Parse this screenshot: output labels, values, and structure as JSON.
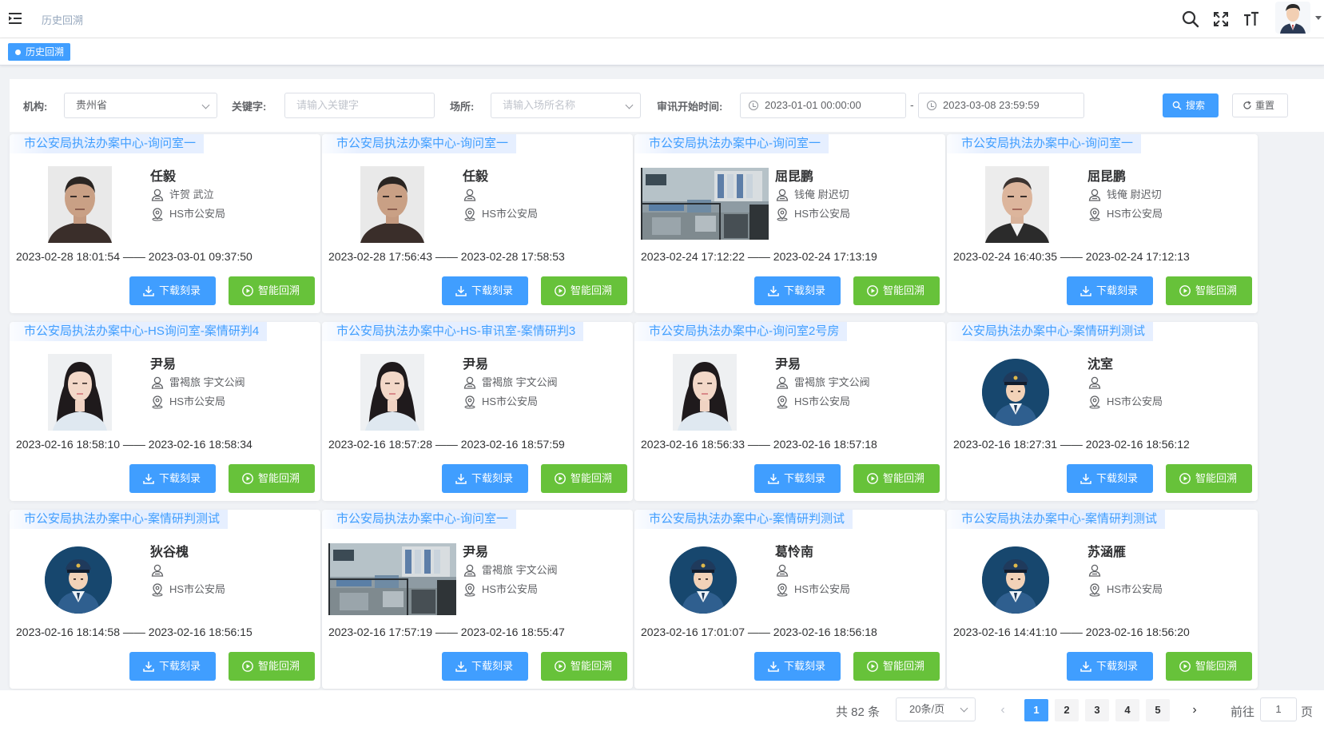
{
  "header": {
    "breadcrumb": "历史回溯",
    "icons": [
      "menu-icon",
      "search-icon",
      "fullscreen-icon",
      "font-size-icon"
    ]
  },
  "tags": {
    "active_tag": "历史回溯"
  },
  "filter": {
    "org_label": "机构:",
    "org_value": "贵州省",
    "keyword_label": "关键字:",
    "keyword_placeholder": "请输入关键字",
    "place_label": "场所:",
    "place_placeholder": "请输入场所名称",
    "time_label": "审讯开始时间:",
    "start_time": "2023-01-01 00:00:00",
    "range_sep": "-",
    "end_time": "2023-03-08 23:59:59",
    "search_label": "搜索",
    "reset_label": "重置"
  },
  "card_buttons": {
    "download": "下载刻录",
    "playback": "智能回溯"
  },
  "cards": [
    {
      "title": "市公安局执法办案中心-询问室一",
      "name": "任毅",
      "people": "许贺 武泣",
      "unit": "HS市公安局",
      "time": "2023-02-28 18:01:54 —— 2023-03-01 09:37:50",
      "photo": "man"
    },
    {
      "title": "市公安局执法办案中心-询问室一",
      "name": "任毅",
      "people": "",
      "unit": "HS市公安局",
      "time": "2023-02-28 17:56:43 —— 2023-02-28 17:58:53",
      "photo": "man"
    },
    {
      "title": "市公安局执法办案中心-询问室一",
      "name": "屈昆鹏",
      "people": "钱俺 尉迟切",
      "unit": "HS市公安局",
      "time": "2023-02-24 17:12:22 —— 2023-02-24 17:13:19",
      "photo": "scene"
    },
    {
      "title": "市公安局执法办案中心-询问室一",
      "name": "屈昆鹏",
      "people": "钱俺 尉迟切",
      "unit": "HS市公安局",
      "time": "2023-02-24 16:40:35 —— 2023-02-24 17:12:13",
      "photo": "man2"
    },
    {
      "title": "市公安局执法办案中心-HS询问室-案情研判4",
      "name": "尹易",
      "people": "雷褐旅 宇文公阀",
      "unit": "HS市公安局",
      "time": "2023-02-16 18:58:10 —— 2023-02-16 18:58:34",
      "photo": "woman"
    },
    {
      "title": "市公安局执法办案中心-HS-审讯室-案情研判3",
      "name": "尹易",
      "people": "雷褐旅 宇文公阀",
      "unit": "HS市公安局",
      "time": "2023-02-16 18:57:28 —— 2023-02-16 18:57:59",
      "photo": "woman"
    },
    {
      "title": "市公安局执法办案中心-询问室2号房",
      "name": "尹易",
      "people": "雷褐旅 宇文公阀",
      "unit": "HS市公安局",
      "time": "2023-02-16 18:56:33 —— 2023-02-16 18:57:18",
      "photo": "woman"
    },
    {
      "title": "公安局执法办案中心-案情研判测试",
      "name": "沈室",
      "people": "",
      "unit": "HS市公安局",
      "time": "2023-02-16 18:27:31 —— 2023-02-16 18:56:12",
      "photo": "police"
    },
    {
      "title": "市公安局执法办案中心-案情研判测试",
      "name": "狄谷槐",
      "people": "",
      "unit": "HS市公安局",
      "time": "2023-02-16 18:14:58 —— 2023-02-16 18:56:15",
      "photo": "police"
    },
    {
      "title": "市公安局执法办案中心-询问室一",
      "name": "尹易",
      "people": "雷褐旅 宇文公阀",
      "unit": "HS市公安局",
      "time": "2023-02-16 17:57:19 —— 2023-02-16 18:55:47",
      "photo": "scene"
    },
    {
      "title": "市公安局执法办案中心-案情研判测试",
      "name": "葛怜南",
      "people": "",
      "unit": "HS市公安局",
      "time": "2023-02-16 17:01:07 —— 2023-02-16 18:56:18",
      "photo": "police"
    },
    {
      "title": "市公安局执法办案中心-案情研判测试",
      "name": "苏涵雁",
      "people": "",
      "unit": "HS市公安局",
      "time": "2023-02-16 14:41:10 —— 2023-02-16 18:56:20",
      "photo": "police"
    }
  ],
  "pagination": {
    "total": "共 82 条",
    "page_size": "20条/页",
    "pages": [
      "1",
      "2",
      "3",
      "4",
      "5"
    ],
    "current": "1",
    "prev": "‹",
    "next": "›",
    "goto_label": "前往",
    "goto_value": "1",
    "page_suffix": "页"
  },
  "colors": {
    "primary": "#409eff",
    "success": "#67c23a",
    "title_bg": "#e6efff",
    "police_bg": "#17476e"
  }
}
